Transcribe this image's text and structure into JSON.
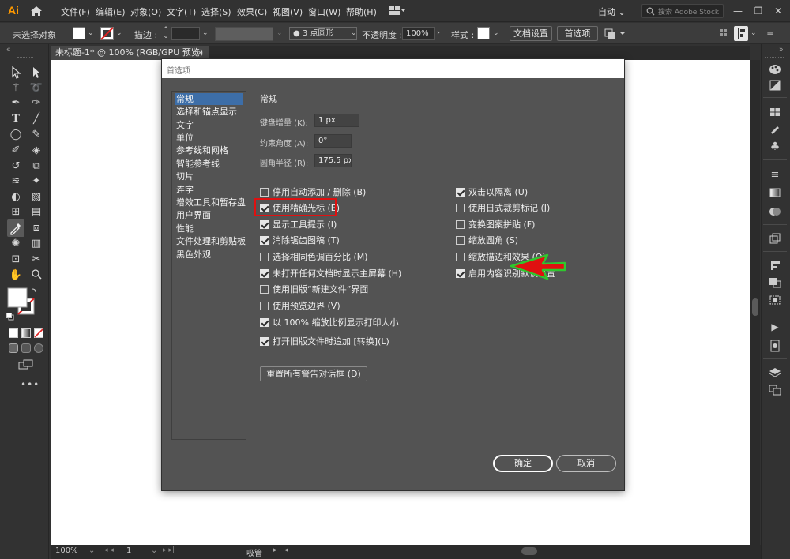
{
  "app": {
    "logo_text": "Ai"
  },
  "menubar": {
    "items": [
      "文件(F)",
      "编辑(E)",
      "对象(O)",
      "文字(T)",
      "选择(S)",
      "效果(C)",
      "视图(V)",
      "窗口(W)",
      "帮助(H)"
    ],
    "workspace": "自动",
    "search_placeholder": "搜索 Adobe Stock",
    "window_controls": [
      "—",
      "❐",
      "✕"
    ]
  },
  "controlbar": {
    "selection_status": "未选择对象",
    "stroke_label": "描边 :",
    "brush_value": "3 点圆形",
    "opacity_label": "不透明度 :",
    "opacity_value": "100%",
    "style_label": "样式 :",
    "doc_settings_button": "文档设置",
    "preferences_button": "首选项"
  },
  "document_tab": {
    "title": "未标题-1* @ 100% (RGB/GPU 预览)",
    "close": "×"
  },
  "statusbar": {
    "zoom": "100%",
    "artboard_number": "1",
    "tool_name": "吸管"
  },
  "dialog": {
    "title": "首选项",
    "categories": [
      {
        "label": "常规",
        "selected": true
      },
      {
        "label": "选择和锚点显示",
        "selected": false
      },
      {
        "label": "文字",
        "selected": false
      },
      {
        "label": "单位",
        "selected": false
      },
      {
        "label": "参考线和网格",
        "selected": false
      },
      {
        "label": "智能参考线",
        "selected": false
      },
      {
        "label": "切片",
        "selected": false
      },
      {
        "label": "连字",
        "selected": false
      },
      {
        "label": "增效工具和暂存盘",
        "selected": false
      },
      {
        "label": "用户界面",
        "selected": false
      },
      {
        "label": "性能",
        "selected": false
      },
      {
        "label": "文件处理和剪贴板",
        "selected": false
      },
      {
        "label": "黑色外观",
        "selected": false
      }
    ],
    "section_title": "常规",
    "fields": {
      "keyboard_increment": {
        "label": "键盘增量 (K):",
        "value": "1 px"
      },
      "constrain_angle": {
        "label": "约束角度 (A):",
        "value": "0°"
      },
      "corner_radius": {
        "label": "圆角半径 (R):",
        "value": "175.5 px"
      }
    },
    "left_options": [
      {
        "label": "停用自动添加 / 删除 (B)",
        "checked": false
      },
      {
        "label": "使用精确光标 (E)",
        "checked": true
      },
      {
        "label": "显示工具提示 (I)",
        "checked": true
      },
      {
        "label": "消除锯齿图稿 (T)",
        "checked": true
      },
      {
        "label": "选择相同色调百分比 (M)",
        "checked": false
      },
      {
        "label": "未打开任何文档时显示主屏幕 (H)",
        "checked": true
      },
      {
        "label": "使用旧版“新建文件”界面",
        "checked": false
      },
      {
        "label": "使用预览边界 (V)",
        "checked": false
      },
      {
        "label": "以 100% 缩放比例显示打印大小",
        "checked": true
      },
      {
        "label": "打开旧版文件时追加 [转换](L)",
        "checked": true
      }
    ],
    "right_options": [
      {
        "label": "双击以隔离 (U)",
        "checked": true
      },
      {
        "label": "使用日式裁剪标记 (J)",
        "checked": false
      },
      {
        "label": "变换图案拼贴 (F)",
        "checked": false
      },
      {
        "label": "缩放圆角 (S)",
        "checked": false
      },
      {
        "label": "缩放描边和效果 (O)",
        "checked": false
      },
      {
        "label": "启用内容识别默认设置",
        "checked": true
      }
    ],
    "reset_button": "重置所有警告对话框 (D)",
    "ok_button": "确定",
    "cancel_button": "取消"
  },
  "colors": {
    "annotation_arrow": "#e01010",
    "annotation_arrow_outline": "#2ec72e",
    "selected_category": "#3d6ea8"
  }
}
